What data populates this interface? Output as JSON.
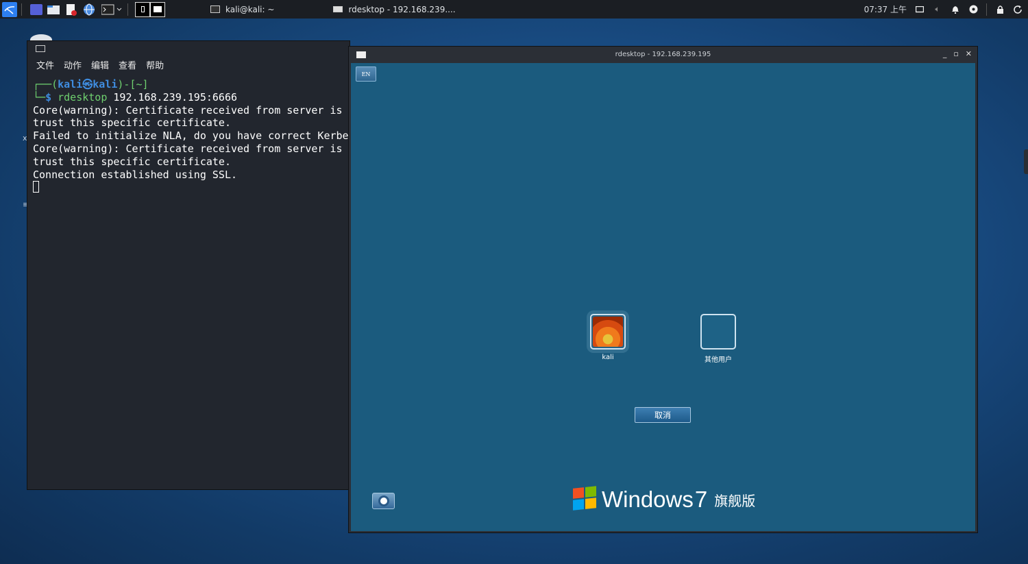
{
  "taskbar": {
    "tasks": [
      {
        "label": "kali@kali: ~"
      },
      {
        "label": "rdesktop - 192.168.239...."
      }
    ],
    "clock": "07:37 上午"
  },
  "terminal": {
    "menu": [
      "文件",
      "动作",
      "编辑",
      "查看",
      "帮助"
    ],
    "prompt_top_prefix": "┌──(",
    "prompt_user": "kali㉿kali",
    "prompt_top_suffix": ")-[~]",
    "prompt_bottom_prefix": "└─",
    "prompt_symbol": "$",
    "command_name": "rdesktop",
    "command_args": " 192.168.239.195:6666",
    "output": [
      "Core(warning): Certificate received from server is N",
      "trust this specific certificate.",
      "Failed to initialize NLA, do you have correct Kerber",
      "Core(warning): Certificate received from server is N",
      "trust this specific certificate.",
      "Connection established using SSL."
    ]
  },
  "rdesktop": {
    "title": "rdesktop - 192.168.239.195",
    "win7": {
      "lang_button": "EN",
      "users": [
        {
          "name": "kali"
        },
        {
          "name": "其他用户"
        }
      ],
      "cancel_label": "取消",
      "brand_word": "Windows",
      "brand_version": "7",
      "brand_edition": "旗舰版",
      "flag_colors": [
        "#f25022",
        "#7fba00",
        "#00a4ef",
        "#ffb900"
      ]
    }
  }
}
